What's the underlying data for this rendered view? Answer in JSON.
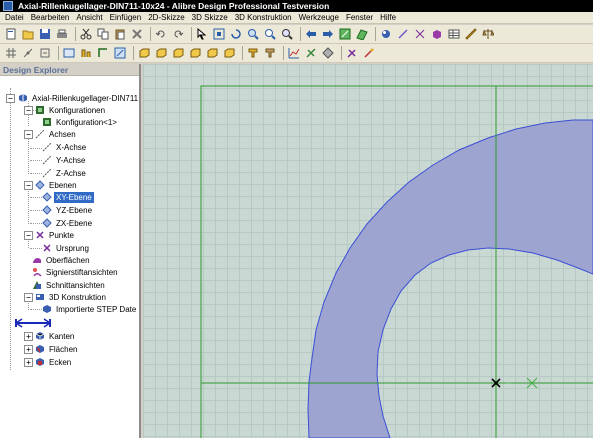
{
  "window": {
    "title": "Axial-Rillenkugellager-DIN711-10x24 - Alibre Design Professional Testversion"
  },
  "menu": [
    "Datei",
    "Bearbeiten",
    "Ansicht",
    "Einfügen",
    "2D-Skizze",
    "3D Skizze",
    "3D Konstruktion",
    "Werkzeuge",
    "Fenster",
    "Hilfe"
  ],
  "explorer": {
    "title": "Design Explorer",
    "root": "Axial-Rillenkugellager-DIN711",
    "konfigurationen": "Konfigurationen",
    "konfiguration1": "Konfiguration<1>",
    "achsen": "Achsen",
    "x_achse": "X-Achse",
    "y_achse": "Y-Achse",
    "z_achse": "Z-Achse",
    "ebenen": "Ebenen",
    "xy_ebene": "XY-Ebene",
    "yz_ebene": "YZ-Ebene",
    "zx_ebene": "ZX-Ebene",
    "punkte": "Punkte",
    "ursprung": "Ursprung",
    "oberflaechen": "Oberflächen",
    "signierstift": "Signierstiftansichten",
    "schnitt": "Schnittansichten",
    "konstruktion3d": "3D Konstruktion",
    "step": "Importierte STEP Date",
    "kanten": "Kanten",
    "flaechen": "Flächen",
    "ecken": "Ecken"
  },
  "colors": {
    "viewport_bg": "#c9d8d3",
    "part_fill": "#9da4d0",
    "part_edge": "#3c4fd6",
    "sketch_lines": "#2f9a2f",
    "selection": "#316ac5"
  },
  "icons": {
    "toolbar1": [
      "new-icon",
      "open-icon",
      "save-icon",
      "print-icon",
      "cut-icon",
      "copy-icon",
      "paste-icon",
      "delete-icon",
      "undo-icon",
      "redo-icon",
      "select-icon",
      "fit-icon",
      "rotate-icon",
      "zoom-in-icon",
      "zoom-area-icon",
      "zoom-icon",
      "back-icon",
      "forward-icon",
      "sketch-icon",
      "plane-icon",
      "render-icon",
      "line-icon",
      "point-icon",
      "part-icon",
      "table-icon",
      "measure-icon",
      "balance-icon"
    ],
    "toolbar2": [
      "grid-icon",
      "snap-icon",
      "constraint-icon",
      "dimension-icon",
      "layer-icon",
      "ortho-icon",
      "view-iso-icon",
      "view-front-icon",
      "view-back-icon",
      "view-left-icon",
      "view-right-icon",
      "view-top-icon",
      "view-bottom-icon",
      "view-normal-icon",
      "view-section-icon",
      "analysis-icon",
      "material-icon",
      "sheet-icon",
      "tools-icon",
      "help-icon"
    ]
  }
}
